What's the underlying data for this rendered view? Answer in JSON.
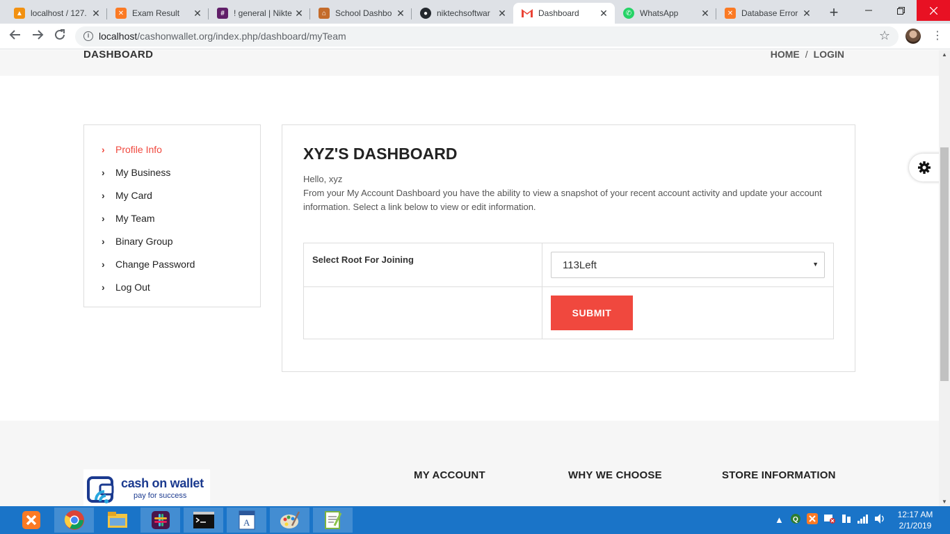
{
  "browser": {
    "tabs": [
      {
        "title": "localhost / 127.",
        "favicon": "phpmyadmin-icon",
        "color": "#f29111",
        "active": false
      },
      {
        "title": "Exam Result",
        "favicon": "xampp-icon",
        "color": "#fb7a24",
        "active": false
      },
      {
        "title": "! general | Nikte",
        "favicon": "slack-icon",
        "color": "#611f69",
        "active": false
      },
      {
        "title": "School Dashbo",
        "favicon": "school-icon",
        "color": "#c46b2a",
        "active": false
      },
      {
        "title": "niktechsoftwar",
        "favicon": "github-icon",
        "color": "#24292e",
        "active": false
      },
      {
        "title": "Dashboard",
        "favicon": "gmail-icon",
        "color": "#ea4335",
        "active": true
      },
      {
        "title": "WhatsApp",
        "favicon": "whatsapp-icon",
        "color": "#25d366",
        "active": false
      },
      {
        "title": "Database Error",
        "favicon": "xampp-icon",
        "color": "#fb7a24",
        "active": false
      }
    ],
    "url_host": "localhost",
    "url_path": "/cashonwallet.org/index.php/dashboard/myTeam"
  },
  "page": {
    "heading": "DASHBOARD",
    "breadcrumb": {
      "home": "HOME",
      "separator": "/",
      "login": "LOGIN"
    },
    "sidebar": {
      "items": [
        {
          "label": "Profile Info",
          "active": true
        },
        {
          "label": "My Business",
          "active": false
        },
        {
          "label": "My Card",
          "active": false
        },
        {
          "label": "My Team",
          "active": false
        },
        {
          "label": "Binary Group",
          "active": false
        },
        {
          "label": "Change Password",
          "active": false
        },
        {
          "label": "Log Out",
          "active": false
        }
      ]
    },
    "main": {
      "title": "XYZ'S DASHBOARD",
      "greeting": "Hello, xyz",
      "description": "From your My Account Dashboard you have the ability to view a snapshot of your recent account activity and update your account information. Select a link below to view or edit information.",
      "form": {
        "root_label": "Select Root For Joining",
        "root_selected": "113Left",
        "submit_label": "SUBMIT"
      }
    },
    "footer": {
      "logo_brand": "cash on wallet",
      "logo_tagline": "pay for success",
      "columns": [
        "MY ACCOUNT",
        "WHY WE CHOOSE",
        "STORE INFORMATION"
      ]
    },
    "accent_color": "#f0483e"
  },
  "taskbar": {
    "apps": [
      "xampp-icon",
      "chrome-icon",
      "file-explorer-icon",
      "slack-icon",
      "cmd-icon",
      "wordpad-icon",
      "paint-icon",
      "notepad-plus-icon"
    ],
    "time": "12:17 AM",
    "date": "2/1/2019"
  }
}
